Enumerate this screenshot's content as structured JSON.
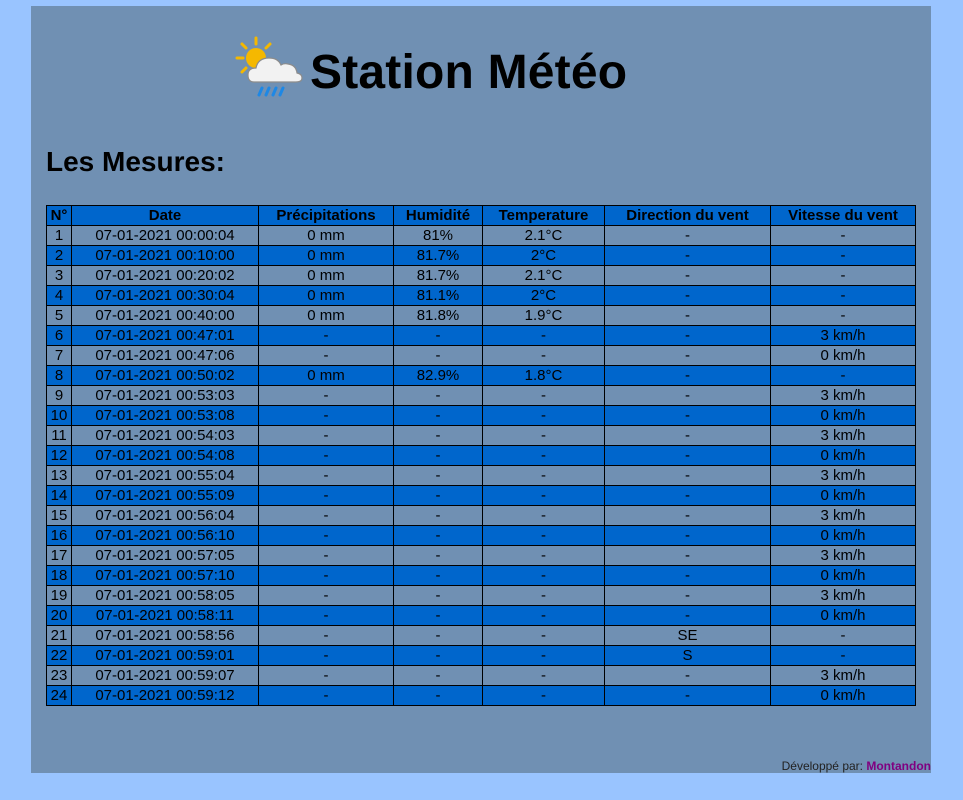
{
  "header": {
    "title": "Station Météo",
    "icon": "sun-cloud-rain-icon"
  },
  "section_title": "Les Mesures:",
  "table": {
    "columns": [
      "N°",
      "Date",
      "Précipitations",
      "Humidité",
      "Temperature",
      "Direction du vent",
      "Vitesse du vent"
    ],
    "rows": [
      [
        "1",
        "07-01-2021 00:00:04",
        "0 mm",
        "81%",
        "2.1°C",
        "-",
        "-"
      ],
      [
        "2",
        "07-01-2021 00:10:00",
        "0 mm",
        "81.7%",
        "2°C",
        "-",
        "-"
      ],
      [
        "3",
        "07-01-2021 00:20:02",
        "0 mm",
        "81.7%",
        "2.1°C",
        "-",
        "-"
      ],
      [
        "4",
        "07-01-2021 00:30:04",
        "0 mm",
        "81.1%",
        "2°C",
        "-",
        "-"
      ],
      [
        "5",
        "07-01-2021 00:40:00",
        "0 mm",
        "81.8%",
        "1.9°C",
        "-",
        "-"
      ],
      [
        "6",
        "07-01-2021 00:47:01",
        "-",
        "-",
        "-",
        "-",
        "3 km/h"
      ],
      [
        "7",
        "07-01-2021 00:47:06",
        "-",
        "-",
        "-",
        "-",
        "0 km/h"
      ],
      [
        "8",
        "07-01-2021 00:50:02",
        "0 mm",
        "82.9%",
        "1.8°C",
        "-",
        "-"
      ],
      [
        "9",
        "07-01-2021 00:53:03",
        "-",
        "-",
        "-",
        "-",
        "3 km/h"
      ],
      [
        "10",
        "07-01-2021 00:53:08",
        "-",
        "-",
        "-",
        "-",
        "0 km/h"
      ],
      [
        "11",
        "07-01-2021 00:54:03",
        "-",
        "-",
        "-",
        "-",
        "3 km/h"
      ],
      [
        "12",
        "07-01-2021 00:54:08",
        "-",
        "-",
        "-",
        "-",
        "0 km/h"
      ],
      [
        "13",
        "07-01-2021 00:55:04",
        "-",
        "-",
        "-",
        "-",
        "3 km/h"
      ],
      [
        "14",
        "07-01-2021 00:55:09",
        "-",
        "-",
        "-",
        "-",
        "0 km/h"
      ],
      [
        "15",
        "07-01-2021 00:56:04",
        "-",
        "-",
        "-",
        "-",
        "3 km/h"
      ],
      [
        "16",
        "07-01-2021 00:56:10",
        "-",
        "-",
        "-",
        "-",
        "0 km/h"
      ],
      [
        "17",
        "07-01-2021 00:57:05",
        "-",
        "-",
        "-",
        "-",
        "3 km/h"
      ],
      [
        "18",
        "07-01-2021 00:57:10",
        "-",
        "-",
        "-",
        "-",
        "0 km/h"
      ],
      [
        "19",
        "07-01-2021 00:58:05",
        "-",
        "-",
        "-",
        "-",
        "3 km/h"
      ],
      [
        "20",
        "07-01-2021 00:58:11",
        "-",
        "-",
        "-",
        "-",
        "0 km/h"
      ],
      [
        "21",
        "07-01-2021 00:58:56",
        "-",
        "-",
        "-",
        "SE",
        "-"
      ],
      [
        "22",
        "07-01-2021 00:59:01",
        "-",
        "-",
        "-",
        "S",
        "-"
      ],
      [
        "23",
        "07-01-2021 00:59:07",
        "-",
        "-",
        "-",
        "-",
        "3 km/h"
      ],
      [
        "24",
        "07-01-2021 00:59:12",
        "-",
        "-",
        "-",
        "-",
        "0 km/h"
      ]
    ]
  },
  "footer": {
    "prefix": "Développé par: ",
    "author": "Montandon"
  },
  "colors": {
    "page_background": "#99c4ff",
    "panel_background": "#7090b3",
    "row_alt_background": "#0066cc",
    "author_link": "#800080"
  }
}
